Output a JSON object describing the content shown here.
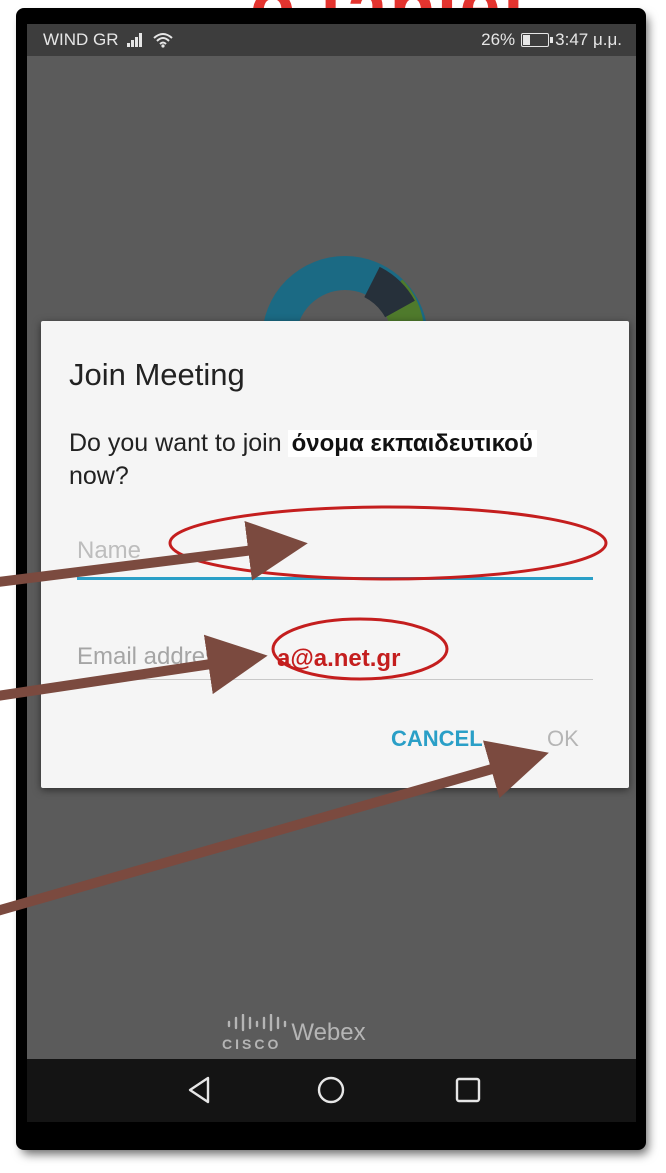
{
  "overlay": {
    "top_text": "o tablet"
  },
  "statusbar": {
    "carrier": "WIND GR",
    "battery_percent": "26%",
    "time": "3:47 μ.μ.",
    "signal_icon": "signal-bars-icon",
    "wifi_icon": "wifi-icon",
    "battery_icon": "battery-icon",
    "battery_level": 0.26
  },
  "dialog": {
    "title": "Join Meeting",
    "question_prefix": "Do you want to join",
    "host_name": "όνομα εκπαιδευτικού",
    "question_suffix": "now?",
    "name_placeholder": "Name",
    "email_placeholder": "Email address",
    "email_value": "a@a.net.gr",
    "cancel_label": "CANCEL",
    "ok_label": "OK"
  },
  "brand": {
    "cisco_text": "CISCO",
    "webex_text": "Webex",
    "logo_icon": "webex-ring-logo"
  },
  "navbar": {
    "back_icon": "back-triangle-icon",
    "home_icon": "home-circle-icon",
    "recents_icon": "recents-square-icon"
  },
  "colors": {
    "accent_blue": "#2a9fc7",
    "annotation_red": "#c41e1e",
    "arrow_brown": "#7b4a3f"
  }
}
